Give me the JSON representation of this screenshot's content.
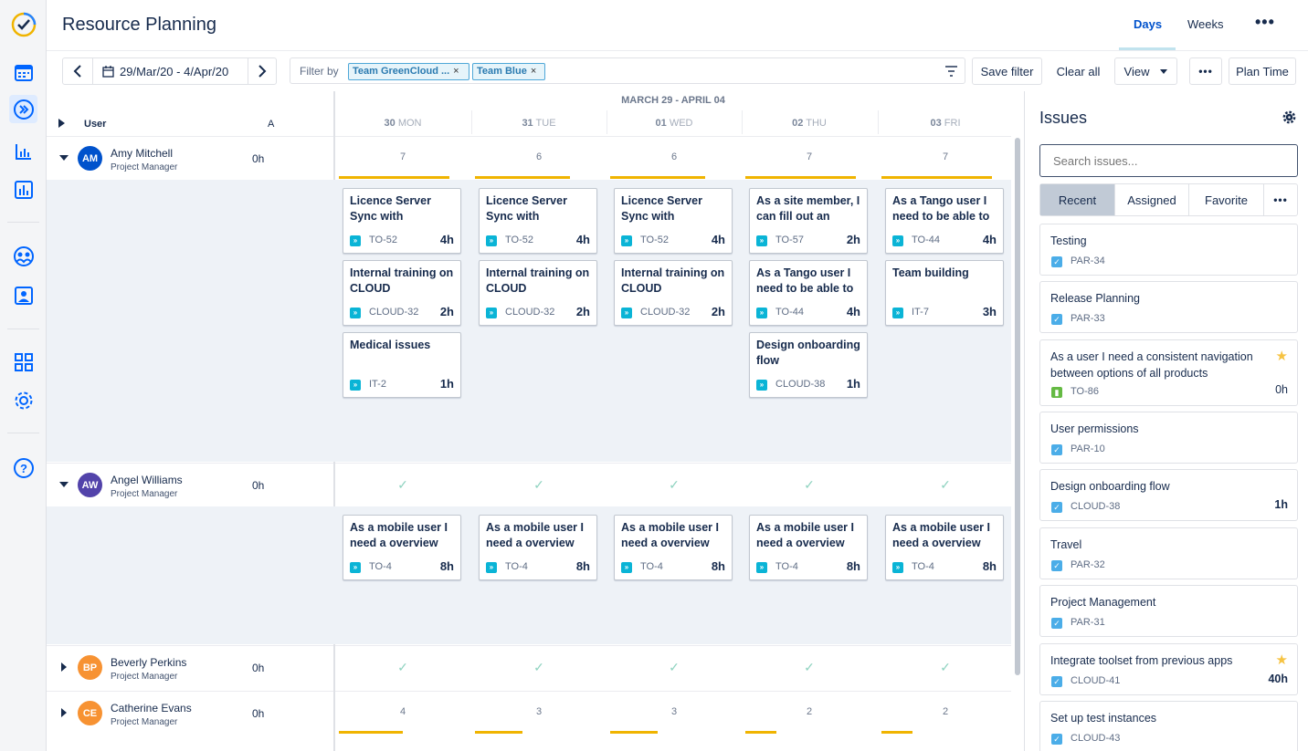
{
  "header": {
    "title": "Resource Planning",
    "tabs": [
      {
        "label": "Days",
        "active": true
      },
      {
        "label": "Weeks",
        "active": false
      }
    ],
    "more_label": "•••"
  },
  "toolbar": {
    "date_range": "29/Mar/20 - 4/Apr/20",
    "prev_label": "‹",
    "next_label": "›",
    "filter_label": "Filter by",
    "filter_chips": [
      "Team GreenCloud ...",
      "Team Blue"
    ],
    "chip_close": "×",
    "save_filter": "Save filter",
    "clear_all": "Clear all",
    "view": "View",
    "more": "•••",
    "plan_time": "Plan Time"
  },
  "grid": {
    "user_header": "User",
    "a_header": "A",
    "range_label": "MARCH 29 - APRIL 04",
    "days": [
      {
        "num": "30",
        "name": "MON"
      },
      {
        "num": "31",
        "name": "TUE"
      },
      {
        "num": "01",
        "name": "WED"
      },
      {
        "num": "02",
        "name": "THU"
      },
      {
        "num": "03",
        "name": "FRI"
      }
    ]
  },
  "users": [
    {
      "initials": "AM",
      "name": "Amy Mitchell",
      "role": "Project Manager",
      "hours": "0h",
      "color": "#0052cc",
      "expanded": true,
      "summary": [
        "7",
        "6",
        "6",
        "7",
        "7"
      ],
      "load": [
        0.82,
        0.7,
        0.7,
        0.82,
        0.82
      ],
      "cards": [
        [
          {
            "title": "Licence Server Sync with",
            "key": "TO-52",
            "hours": "4h"
          },
          {
            "title": "Internal training on CLOUD",
            "key": "CLOUD-32",
            "hours": "2h"
          },
          {
            "title": "Medical issues",
            "key": "IT-2",
            "hours": "1h"
          }
        ],
        [
          {
            "title": "Licence Server Sync with",
            "key": "TO-52",
            "hours": "4h"
          },
          {
            "title": "Internal training on CLOUD",
            "key": "CLOUD-32",
            "hours": "2h"
          }
        ],
        [
          {
            "title": "Licence Server Sync with",
            "key": "TO-52",
            "hours": "4h"
          },
          {
            "title": "Internal training on CLOUD",
            "key": "CLOUD-32",
            "hours": "2h"
          }
        ],
        [
          {
            "title": "As a site member, I can fill out an",
            "key": "TO-57",
            "hours": "2h"
          },
          {
            "title": "As a Tango user I need to be able to",
            "key": "TO-44",
            "hours": "4h"
          },
          {
            "title": "Design onboarding flow",
            "key": "CLOUD-38",
            "hours": "1h"
          }
        ],
        [
          {
            "title": "As a Tango user I need to be able to",
            "key": "TO-44",
            "hours": "4h"
          },
          {
            "title": "Team building",
            "key": "IT-7",
            "hours": "3h"
          }
        ]
      ]
    },
    {
      "initials": "AW",
      "name": "Angel Williams",
      "role": "Project Manager",
      "hours": "0h",
      "color": "#5243aa",
      "expanded": true,
      "summary": [
        "✓",
        "✓",
        "✓",
        "✓",
        "✓"
      ],
      "cards": [
        [
          {
            "title": "As a mobile user I need a overview",
            "key": "TO-4",
            "hours": "8h"
          }
        ],
        [
          {
            "title": "As a mobile user I need a overview",
            "key": "TO-4",
            "hours": "8h"
          }
        ],
        [
          {
            "title": "As a mobile user I need a overview",
            "key": "TO-4",
            "hours": "8h"
          }
        ],
        [
          {
            "title": "As a mobile user I need a overview",
            "key": "TO-4",
            "hours": "8h"
          }
        ],
        [
          {
            "title": "As a mobile user I need a overview",
            "key": "TO-4",
            "hours": "8h"
          }
        ]
      ]
    },
    {
      "initials": "BP",
      "name": "Beverly Perkins",
      "role": "Project Manager",
      "hours": "0h",
      "color": "#f79232",
      "expanded": false,
      "summary": [
        "✓",
        "✓",
        "✓",
        "✓",
        "✓"
      ]
    },
    {
      "initials": "CE",
      "name": "Catherine Evans",
      "role": "Project Manager",
      "hours": "0h",
      "color": "#f79232",
      "expanded": false,
      "summary": [
        "4",
        "3",
        "3",
        "2",
        "2"
      ],
      "load": [
        0.47,
        0.35,
        0.35,
        0.23,
        0.23
      ]
    }
  ],
  "issues_panel": {
    "title": "Issues",
    "search_placeholder": "Search issues...",
    "tabs": [
      "Recent",
      "Assigned",
      "Favorite"
    ],
    "tabs_more": "•••",
    "issues": [
      {
        "title": "Testing",
        "key": "PAR-34",
        "hours": "",
        "type": "task",
        "star": false
      },
      {
        "title": "Release Planning",
        "key": "PAR-33",
        "hours": "",
        "type": "task",
        "star": false
      },
      {
        "title": "As a user I need a consistent navigation between options of all products",
        "key": "TO-86",
        "hours": "0h",
        "type": "story",
        "star": true
      },
      {
        "title": "User permissions",
        "key": "PAR-10",
        "hours": "",
        "type": "task",
        "star": false
      },
      {
        "title": "Design onboarding flow",
        "key": "CLOUD-38",
        "hours": "1h",
        "type": "task",
        "star": false
      },
      {
        "title": "Travel",
        "key": "PAR-32",
        "hours": "",
        "type": "task",
        "star": false
      },
      {
        "title": "Project Management",
        "key": "PAR-31",
        "hours": "",
        "type": "task",
        "star": false
      },
      {
        "title": "Integrate toolset from previous apps",
        "key": "CLOUD-41",
        "hours": "40h",
        "type": "task",
        "star": true
      },
      {
        "title": "Set up test instances",
        "key": "CLOUD-43",
        "hours": "",
        "type": "task",
        "star": false
      }
    ]
  },
  "icons": {
    "nav": [
      "app-logo-icon",
      "calendar-icon",
      "resource-planning-icon",
      "reports-icon",
      "bar-chart-icon",
      "teams-icon",
      "user-icon",
      "dashboard-icon",
      "settings-icon",
      "help-icon"
    ]
  },
  "colors": {
    "accent": "#0052cc",
    "load_bar": "#f0b400",
    "issue_icon": "#0ab4d6"
  }
}
